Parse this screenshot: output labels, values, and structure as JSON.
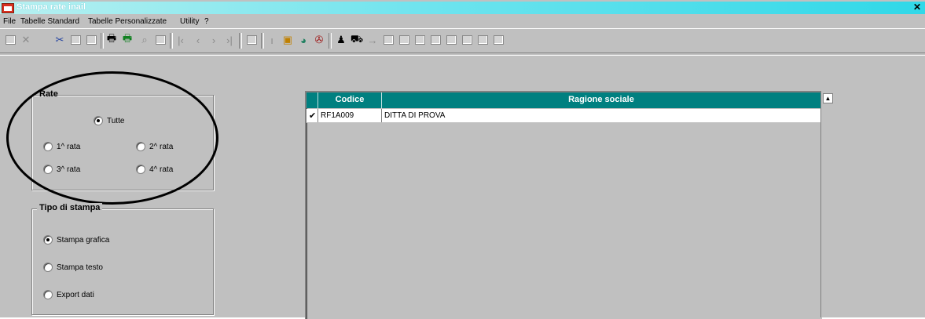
{
  "window": {
    "title": "Stampa rate inail"
  },
  "menu": {
    "items": [
      "File",
      "Tabelle Standard",
      "Tabelle Personalizzate",
      "Utility",
      "?"
    ]
  },
  "toolbar": {
    "icons": [
      "save-icon",
      "delete-icon",
      "cut-icon",
      "copy-icon",
      "paste-icon",
      "print-icon",
      "print-preview-icon",
      "find-icon",
      "window-icon",
      "first-icon",
      "prev-icon",
      "next-icon",
      "last-icon",
      "zoom-icon",
      "info-icon",
      "calculator-icon",
      "globe-icon",
      "tools-icon",
      "person-icon",
      "car-icon",
      "arrow-icon",
      "blank-button-icon"
    ]
  },
  "rate": {
    "label": "Rate",
    "options": [
      "Tutte",
      "1^ rata",
      "2^ rata",
      "3^ rata",
      "4^ rata"
    ],
    "selected": "Tutte"
  },
  "tipo_stampa": {
    "label": "Tipo di stampa",
    "options": [
      "Stampa grafica",
      "Stampa testo",
      "Export dati"
    ],
    "selected": "Stampa grafica"
  },
  "table": {
    "columns": [
      "Codice",
      "Ragione sociale"
    ],
    "rows": [
      {
        "checked": "✔",
        "codice": "RF1A009",
        "ragione_sociale": "DITTA DI PROVA"
      }
    ]
  },
  "colors": {
    "header": "#008080",
    "titlebar": "#30d8e8",
    "face": "#c0c0c0"
  }
}
